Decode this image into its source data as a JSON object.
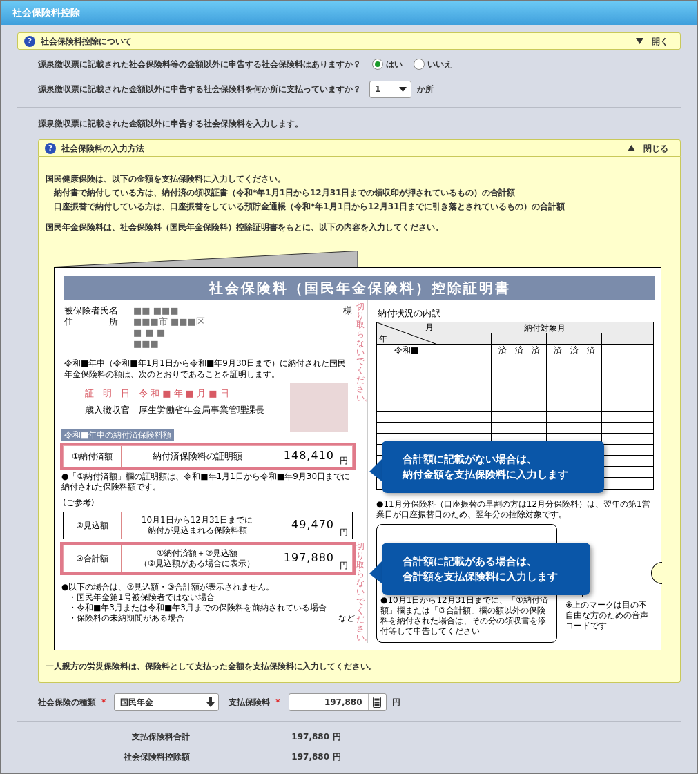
{
  "window": {
    "title": "社会保険料控除"
  },
  "about_panel": {
    "help_mark": "?",
    "title": "社会保険料控除について",
    "toggle": "開く",
    "expanded": false
  },
  "questions": [
    {
      "kind": "radio",
      "label": "源泉徴収票に記載された社会保険料等の金額以外に申告する社会保険料はありますか？",
      "options": [
        {
          "label": "はい",
          "selected": true
        },
        {
          "label": "いいえ",
          "selected": false
        }
      ]
    },
    {
      "kind": "select",
      "label": "源泉徴収票に記載された金額以外に申告する社会保険料を何か所に支払っていますか？",
      "value": "1",
      "suffix": "か所"
    }
  ],
  "intro": "源泉徴収票に記載された金額以外に申告する社会保険料を入力します。",
  "help_panel": {
    "help_mark": "?",
    "title": "社会保険料の入力方法",
    "toggle": "閉じる",
    "expanded": true,
    "paragraphs": [
      {
        "text": "国民健康保険は、以下の金額を支払保険料に入力してください。",
        "children": [
          "納付書で納付している方は、納付済の領収証書（令和*年1月1日から12月31日までの領収印が押されているもの）の合計額",
          "口座振替で納付している方は、口座振替をしている預貯金通帳（令和*年1月1日から12月31日までに引き落とされているもの）の合計額"
        ]
      },
      {
        "text": "国民年金保険料は、社会保険料（国民年金保険料）控除証明書をもとに、以下の内容を入力してください。"
      }
    ],
    "certificate": {
      "title": "社会保険料（国民年金保険料）控除証明書",
      "name_label": "被保険者氏名",
      "name_value": "■■ ■■■",
      "honorific": "様",
      "address_label": [
        "住",
        "所"
      ],
      "address_lines": [
        "■■■市 ■■■区",
        "■-■-■",
        "■■■"
      ],
      "statement": "令和■年中（令和■年1月1日から令和■年9月30日まで）に納付された国民年金保険料の額は、次のとおりであることを証明します。",
      "cert_date": "証　明　日　令 和 ■ 年 ■ 月 ■ 日",
      "issuer": "歳入徴収官　厚生労働省年金局事業管理課長",
      "cut_notes": [
        "切り取らないでください。",
        "切り取らないでください。"
      ],
      "paid_section_title": "令和■年中の納付済保険料額",
      "amount_rows": [
        {
          "label": "①納付済額",
          "description": [
            "納付済保険料の証明額"
          ],
          "amount": "148,410",
          "unit": "円",
          "highlighted": true
        }
      ],
      "paid_note": "●「①納付済額」欄の証明額は、令和■年1月1日から令和■年9月30日までに納付された保険料額です。",
      "reference_label": "(ご参考)",
      "reference_rows": [
        {
          "label": "②見込額",
          "description": [
            "10月1日から12月31日までに",
            "納付が見込まれる保険料額"
          ],
          "amount": "49,470",
          "unit": "円",
          "highlighted": false
        },
        {
          "label": "③合計額",
          "description": [
            "①納付済額＋②見込額",
            "（②見込額がある場合に表示）"
          ],
          "amount": "197,880",
          "unit": "円",
          "highlighted": true
        }
      ],
      "exceptions": {
        "text": "●以下の場合は、②見込額・③合計額が表示されません。",
        "items": [
          "・国民年金第1号被保険者ではない場合",
          "・令和■年3月または令和■年3月までの保険料を前納されている場合",
          "・保険料の未納期間がある場合"
        ],
        "trailer": "など"
      },
      "breakdown_title": "納付状況の内訳",
      "breakdown_table": {
        "corner_top": "月",
        "corner_bottom": "年",
        "group_header": "納付対象月",
        "rows": [
          {
            "year": "令和■",
            "col_2": "済　済　済",
            "col_3": "済　済　済"
          }
        ]
      },
      "early_payment_note": "●11月分保険料（口座振替の早割の方は12月分保険料）は、翌年の第1営業日が口座振替日のため、翌年分の控除対象です。",
      "receipt_note": "●10月1日から12月31日までに、「①納付済額」欄または「③合計額」欄の額以外の保険料を納付された場合は、その分の領収書を添付等して申告してください",
      "voice_code_note": "※上のマークは目の不自由な方のための音声コードです"
    },
    "callouts": [
      {
        "lines": [
          "合計額に記載がない場合は、",
          "納付金額を支払保険料に入力します"
        ]
      },
      {
        "lines": [
          "合計額に記載がある場合は、",
          "合計額を支払保険料に入力します"
        ]
      }
    ],
    "footer": "一人親方の労災保険料は、保険料として支払った金額を支払保険料に入力してください。"
  },
  "form": {
    "type_label": "社会保険の種類",
    "type_required": true,
    "type_required_mark": "*",
    "type_value": "国民年金",
    "amount_label": "支払保険料",
    "amount_required": true,
    "amount_required_mark": "*",
    "amount_value": "197,880",
    "amount_unit": "円"
  },
  "totals": [
    {
      "label": "支払保険料合計",
      "value": "197,880",
      "unit": "円"
    },
    {
      "label": "社会保険料控除額",
      "value": "197,880",
      "unit": "円"
    }
  ]
}
